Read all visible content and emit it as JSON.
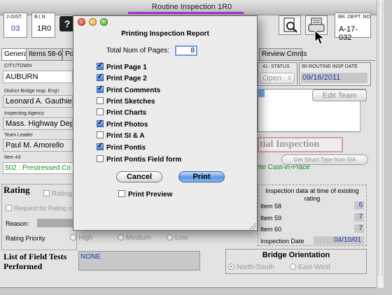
{
  "window": {
    "title": "Routine Inspection 1R0"
  },
  "header": {
    "dist": {
      "label": "2-DIST",
      "value": "03"
    },
    "bin": {
      "label": "B.I.N.",
      "value": "1R0"
    },
    "bridge_dept": {
      "label": "BR. DEPT. NO",
      "value": "A-17-032"
    }
  },
  "tabs": [
    "General",
    "Items 58-61",
    "Pos",
    "Review Cmnts"
  ],
  "form": {
    "city_label": "CITY/TOWN",
    "city_value": "AUBURN",
    "engineer_label": "District Bridge Insp. Eng'r",
    "engineer_value": "Leonard A. Gauthier",
    "agency_label": "Inspecting Agency",
    "agency_value": "Mass. Highway Dept.",
    "leader_label": "Team Leader",
    "leader_value": "Paul M. Amorello",
    "item43_label": "Item 43",
    "item43_value": "502 : Prestressed Co",
    "item43_value_right": "ete Cast-in-Place",
    "struct_type_button": "Get Struct Type from SIA",
    "status_label": "41- STATUS",
    "status_value": "Open",
    "insp_date_label": "90-ROUTINE INSP DATE",
    "insp_date_value": "09/16/2011",
    "edit_team_button": "Edit Team",
    "inspection_banner": "tial Inspection",
    "rating_title": "Rating",
    "rating_check": "Rating",
    "request_rating": "Request for Rating o",
    "reason_label": "Reason:",
    "rating_priority_label": "Rating Priority",
    "priority_options": [
      "High",
      "Medium",
      "Low"
    ],
    "field_tests_title": "List of Field Tests Performed",
    "field_tests_value": "NONE"
  },
  "existing_rating": {
    "title": "Inspection data at time of existing rating",
    "rows": [
      {
        "label": "Item 58",
        "value": "6"
      },
      {
        "label": "Item 59",
        "value": "7"
      },
      {
        "label": "Item 60",
        "value": "7"
      },
      {
        "label": "Inspection Date",
        "value": "04/10/01"
      }
    ]
  },
  "orientation": {
    "title": "Bridge Orientation",
    "options": [
      "North-South",
      "East-West"
    ],
    "selected": "North-South"
  },
  "dialog": {
    "title": "Printing Inspection Report",
    "pages_label": "Total Num of Pages:",
    "pages_value": "8",
    "options": [
      {
        "label": "Print Page 1",
        "checked": true
      },
      {
        "label": "Print Page 2",
        "checked": true
      },
      {
        "label": "Print Comments",
        "checked": true
      },
      {
        "label": "Print Sketches",
        "checked": false
      },
      {
        "label": "Print Charts",
        "checked": false
      },
      {
        "label": "Print Photos",
        "checked": true
      },
      {
        "label": "Print SI & A",
        "checked": false
      },
      {
        "label": "Print Pontis",
        "checked": true
      },
      {
        "label": "Print Pontis Field form",
        "checked": false
      }
    ],
    "cancel_label": "Cancel",
    "print_label": "Print",
    "preview_label": "Print Preview",
    "preview_checked": false
  }
}
